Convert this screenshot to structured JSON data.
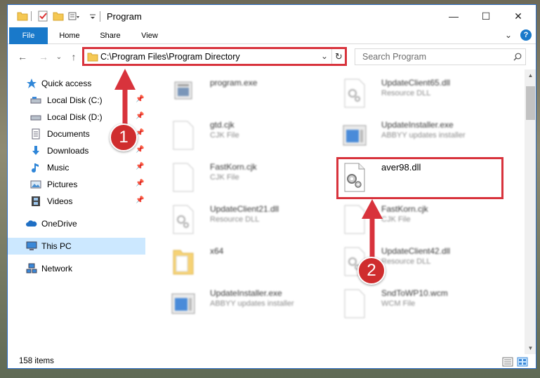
{
  "window": {
    "title": "Program",
    "controls": {
      "minimize": "—",
      "maximize": "☐",
      "close": "✕"
    }
  },
  "ribbon": {
    "tabs": [
      "File",
      "Home",
      "Share",
      "View"
    ],
    "expand": "⌄",
    "help": "?"
  },
  "address": {
    "back": "←",
    "forward": "→",
    "recent": "⌄",
    "up": "↑",
    "path": "C:\\Program Files\\Program Directory",
    "dropdown": "⌄",
    "refresh": "↻"
  },
  "search": {
    "placeholder": "Search Program",
    "icon": "search-icon"
  },
  "sidebar": {
    "quick_access": {
      "label": "Quick access"
    },
    "items": [
      {
        "label": "Local Disk (C:)",
        "icon": "drive-icon",
        "pinned": true
      },
      {
        "label": "Local Disk (D:)",
        "icon": "drive-icon",
        "pinned": true
      },
      {
        "label": "Documents",
        "icon": "documents-icon",
        "pinned": true
      },
      {
        "label": "Downloads",
        "icon": "download-arrow-icon",
        "pinned": true
      },
      {
        "label": "Music",
        "icon": "music-note-icon",
        "pinned": true
      },
      {
        "label": "Pictures",
        "icon": "pictures-icon",
        "pinned": true
      },
      {
        "label": "Videos",
        "icon": "film-icon",
        "pinned": true
      }
    ],
    "onedrive": "OneDrive",
    "this_pc": "This PC",
    "network": "Network"
  },
  "files": [
    {
      "name": "program.exe",
      "type": "",
      "icon": "exe-icon",
      "blurred": true
    },
    {
      "name": "UpdateClient65.dll",
      "type": "Resource DLL",
      "icon": "dll-icon",
      "blurred": true
    },
    {
      "name": "gtd.cjk",
      "type": "CJK File",
      "icon": "blank-file-icon",
      "blurred": true
    },
    {
      "name": "UpdateInstaller.exe",
      "type": "ABBYY updates installer",
      "icon": "installer-icon",
      "blurred": true
    },
    {
      "name": "FastKorn.cjk",
      "type": "CJK File",
      "icon": "blank-file-icon",
      "blurred": true
    },
    {
      "name": "aver98.dll",
      "type": "",
      "icon": "dll-gear-icon",
      "blurred": false
    },
    {
      "name": "UpdateClient21.dll",
      "type": "Resource DLL",
      "icon": "dll-icon",
      "blurred": true
    },
    {
      "name": "FastKorn.cjk",
      "type": "CJK File",
      "icon": "blank-file-icon",
      "blurred": true
    },
    {
      "name": "x64",
      "type": "",
      "icon": "folder-icon",
      "blurred": true
    },
    {
      "name": "UpdateClient42.dll",
      "type": "Resource DLL",
      "icon": "dll-icon",
      "blurred": true
    },
    {
      "name": "UpdateInstaller.exe",
      "type": "ABBYY updates installer",
      "icon": "installer-icon",
      "blurred": true
    },
    {
      "name": "SndToWP10.wcm",
      "type": "WCM File",
      "icon": "blank-file-icon",
      "blurred": true
    }
  ],
  "status": {
    "count": "158 items"
  },
  "annotations": {
    "step1": "1",
    "step2": "2",
    "color": "#d8333c"
  }
}
